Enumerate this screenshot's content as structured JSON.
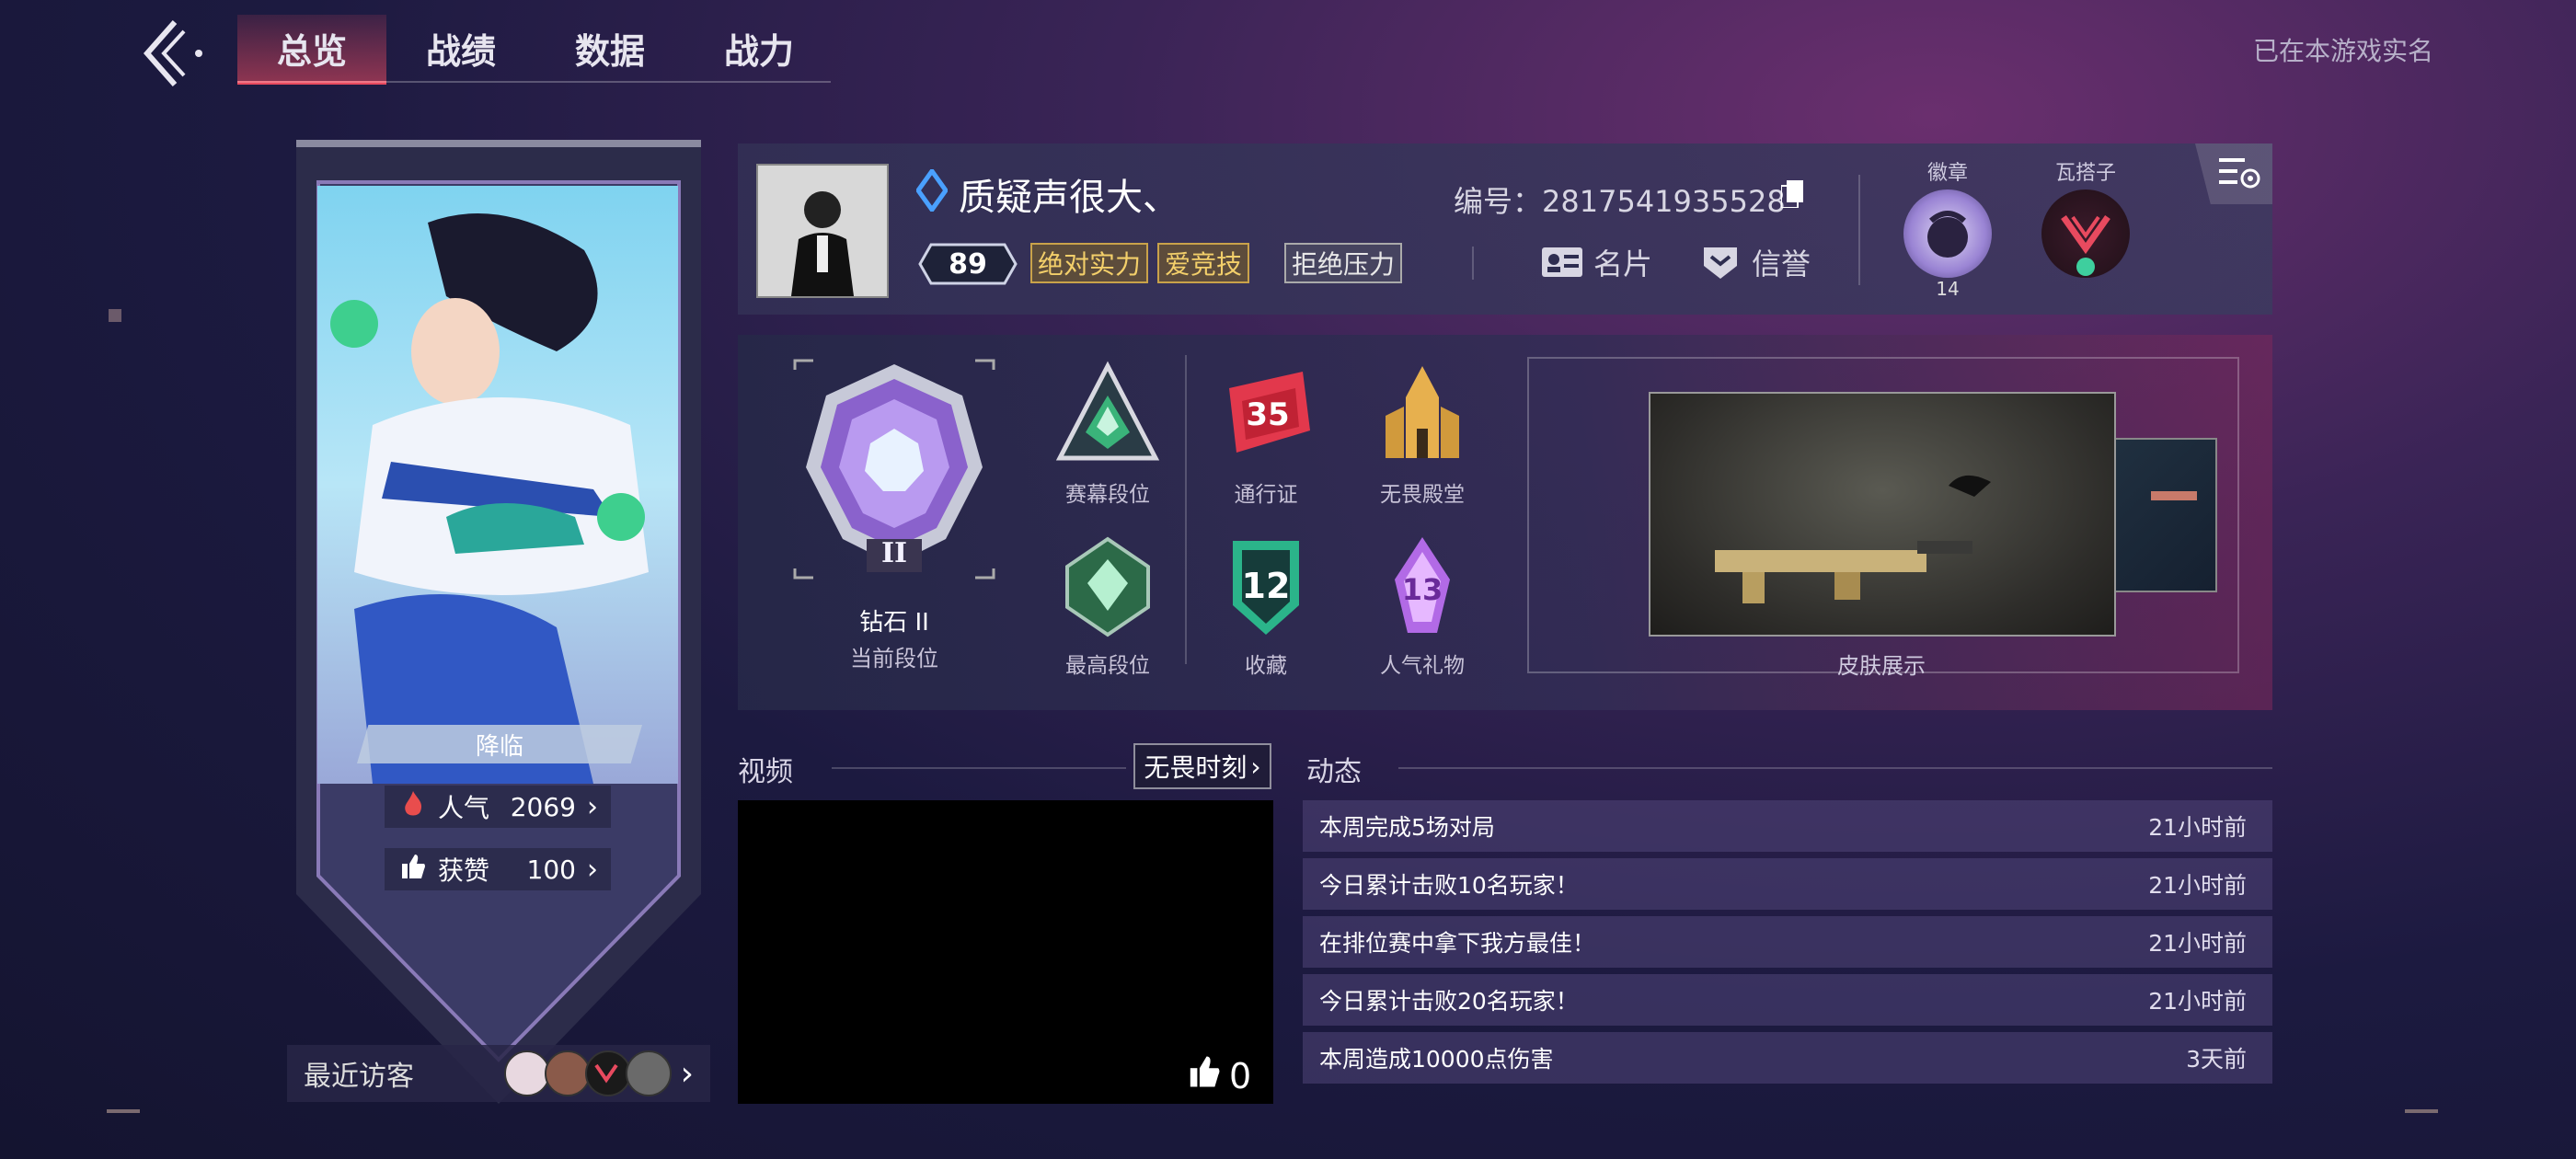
{
  "nav": {
    "tabs": [
      "总览",
      "战绩",
      "数据",
      "战力"
    ],
    "active_tab": 0,
    "verified_text": "已在本游戏实名"
  },
  "banner": {
    "title": "降临",
    "popularity_label": "人气",
    "popularity_value": "2069",
    "likes_label": "获赞",
    "likes_value": "100",
    "visitors_label": "最近访客"
  },
  "profile": {
    "username": "质疑声很大、",
    "level": "89",
    "tags": [
      "绝对实力",
      "爱竞技",
      "拒绝压力"
    ],
    "uid_label": "编号：",
    "uid_value": "2817541935528",
    "card_label": "名片",
    "credit_label": "信誉",
    "badge_label": "徽章",
    "badge_count": "14",
    "partner_label": "瓦搭子"
  },
  "ranks": {
    "current_rank_name": "钻石 II",
    "current_rank_numeral": "II",
    "current_rank_label": "当前段位",
    "items": [
      {
        "label": "赛幕段位"
      },
      {
        "label": "通行证",
        "number": "35"
      },
      {
        "label": "无畏殿堂"
      },
      {
        "label": "最高段位"
      },
      {
        "label": "收藏",
        "number": "12"
      },
      {
        "label": "人气礼物",
        "number": "13"
      }
    ],
    "skin_label": "皮肤展示"
  },
  "video": {
    "title": "视频",
    "link_label": "无畏时刻",
    "likes": "0"
  },
  "feed": {
    "title": "动态",
    "items": [
      {
        "text": "本周完成5场对局",
        "time": "21小时前"
      },
      {
        "text": "今日累计击败10名玩家！",
        "time": "21小时前"
      },
      {
        "text": "在排位赛中拿下我方最佳！",
        "time": "21小时前"
      },
      {
        "text": "今日累计击败20名玩家！",
        "time": "21小时前"
      },
      {
        "text": "本周造成10000点伤害",
        "time": "3天前"
      }
    ]
  },
  "colors": {
    "accent": "#e84a5f",
    "gold_tag": "#f3cf6a",
    "diamond": "#a88be0"
  }
}
